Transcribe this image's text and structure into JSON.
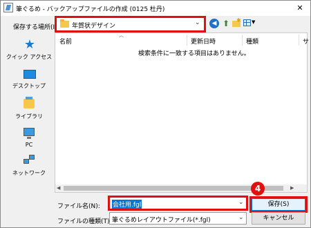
{
  "window": {
    "title": "筆ぐるめ - バックアップファイルの作成 (0125 杜丹)",
    "close_glyph": "✕"
  },
  "location": {
    "label": "保存する場所(I):",
    "value": "年賀状デザイン"
  },
  "toolbar": {
    "icons": [
      "back-icon",
      "up-folder-icon",
      "new-folder-icon",
      "view-menu-icon"
    ]
  },
  "places": [
    {
      "label": "クイック アクセス",
      "icon": "star-icon"
    },
    {
      "label": "デスクトップ",
      "icon": "desktop-icon"
    },
    {
      "label": "ライブラリ",
      "icon": "library-icon"
    },
    {
      "label": "PC",
      "icon": "pc-icon"
    },
    {
      "label": "ネットワーク",
      "icon": "network-icon"
    }
  ],
  "file_list": {
    "columns": [
      "名前",
      "更新日時",
      "種類",
      "サ"
    ],
    "empty_message": "検索条件に一致する項目はありません。"
  },
  "filename": {
    "label": "ファイル名(N):",
    "value": "会社用.fgl"
  },
  "filetype": {
    "label": "ファイルの種類(T):",
    "value": "筆ぐるめレイアウトファイル(*.fgl)"
  },
  "buttons": {
    "save": "保存(S)",
    "cancel": "キャンセル"
  },
  "annotation": {
    "step": "4",
    "highlight_color": "#e01010"
  }
}
